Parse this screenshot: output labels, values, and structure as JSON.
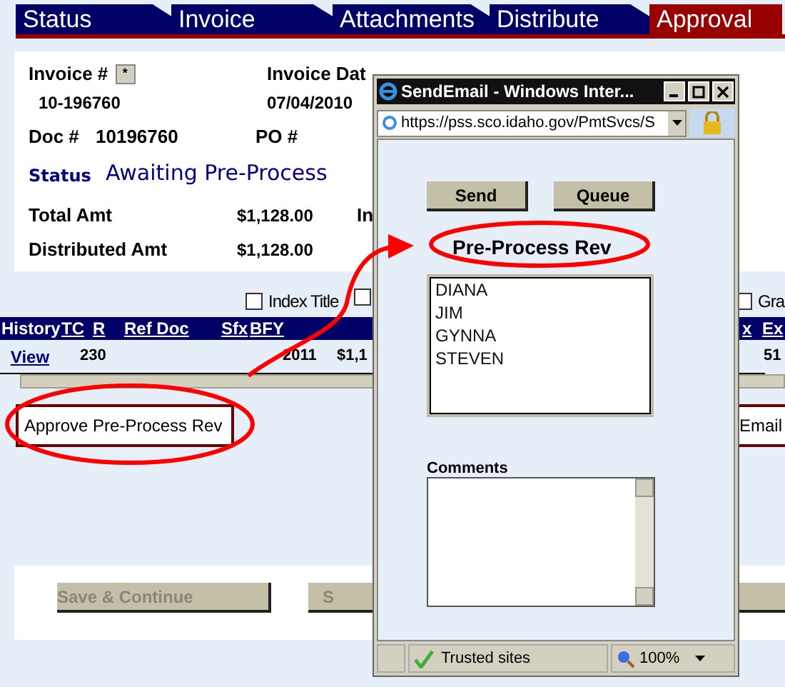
{
  "tabs": [
    {
      "label": "Status",
      "selected": false
    },
    {
      "label": "Invoice",
      "selected": false
    },
    {
      "label": "Attachments",
      "selected": false
    },
    {
      "label": "Distribute",
      "selected": false
    },
    {
      "label": "Approval",
      "selected": true
    }
  ],
  "invoice": {
    "invoice_no_label": "Invoice #",
    "star_button": "*",
    "invoice_no": "10-196760",
    "invoice_date_label": "Invoice Dat",
    "invoice_date": "07/04/2010",
    "doc_label": "Doc #",
    "doc_no": "10196760",
    "po_label": "PO #",
    "status_label": "Status",
    "status": "Awaiting Pre-Process",
    "total_label": "Total Amt",
    "total": "$1,128.00",
    "column_3_label": "In",
    "distributed_label": "Distributed Amt",
    "distributed": "$1,128.00"
  },
  "options": [
    {
      "label": "Index Title",
      "checked": false
    },
    {
      "checked": false
    },
    {
      "label": "Gra",
      "checked": false
    }
  ],
  "table": {
    "columns": [
      "History",
      "TC",
      "R",
      "Ref Doc",
      "Sfx",
      "BFY"
    ],
    "right_columns": [
      "x",
      "Ex"
    ],
    "rows": [
      {
        "history": "View",
        "tc": "230",
        "bfy": "2011",
        "column_7": "$1,1",
        "column_9": "51"
      }
    ]
  },
  "approval_select": "Approve Pre-Process Rev",
  "email_button": "Email",
  "buttons": [
    {
      "label": "Save & Continue",
      "disabled": true
    },
    {
      "label": "S",
      "disabled": true
    }
  ],
  "popup": {
    "title": "SendEmail - Windows Inter...",
    "url": "https://pss.sco.idaho.gov/PmtSvcs/S",
    "buttons": [
      "Send",
      "Queue"
    ],
    "group": "Pre-Process Rev",
    "recipients": [
      "DIANA",
      "JIM",
      "GYNNA",
      "STEVEN"
    ],
    "comments_label": "Comments",
    "zone": "Trusted sites",
    "zoom": "100%"
  }
}
